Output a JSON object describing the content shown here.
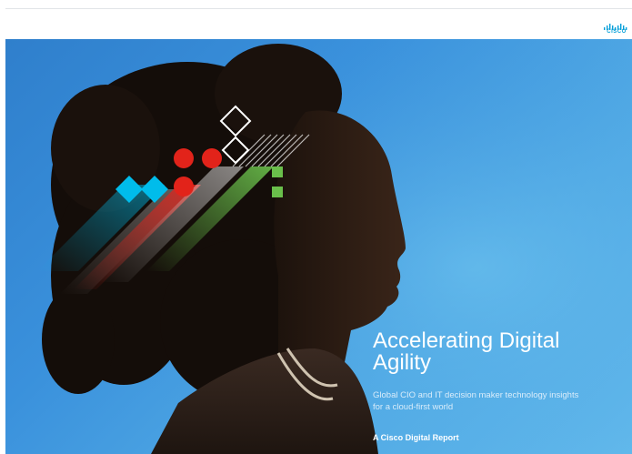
{
  "header": {
    "logo_text": "CISCO",
    "logo_icon": "cisco-bridge-icon"
  },
  "hero": {
    "title_line1": "Accelerating Digital",
    "title_line2": "Agility",
    "subtitle_line1": "Global CIO and IT decision maker technology insights",
    "subtitle_line2": "for a cloud-first world",
    "report_label": "A Cisco Digital Report"
  },
  "colors": {
    "sky": "#3a91dc",
    "cisco_blue": "#049fd9",
    "accent_red": "#e2231a",
    "accent_green": "#6abf4b",
    "accent_cyan": "#00bceb"
  }
}
